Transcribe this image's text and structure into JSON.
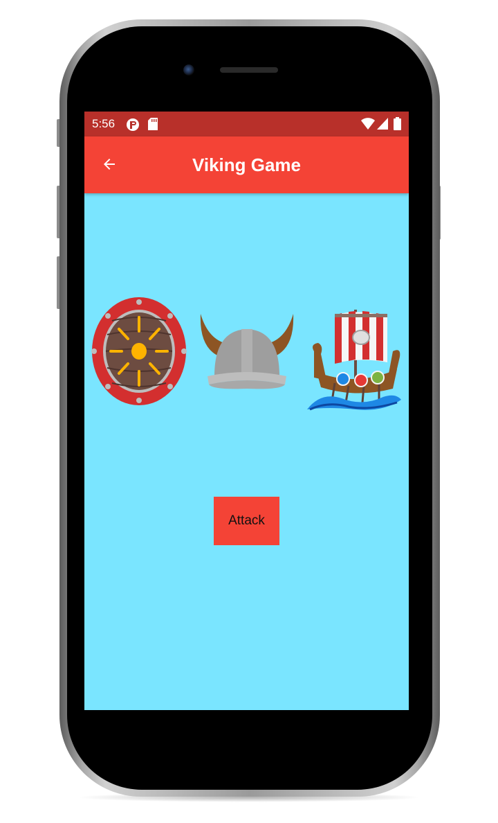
{
  "status_bar": {
    "time": "5:56",
    "left_icons": [
      "notification-p-icon",
      "sd-card-icon"
    ],
    "right_icons": [
      "wifi-icon",
      "signal-icon",
      "battery-icon"
    ],
    "color": "#b8302a"
  },
  "app_bar": {
    "title": "Viking Game",
    "back_icon": "arrow-left-icon",
    "color": "#f44336"
  },
  "content": {
    "background": "#7ae5ff",
    "images": [
      {
        "name": "viking-shield"
      },
      {
        "name": "viking-helmet"
      },
      {
        "name": "viking-ship"
      }
    ],
    "action_button": {
      "label": "Attack",
      "color": "#f44336"
    }
  }
}
